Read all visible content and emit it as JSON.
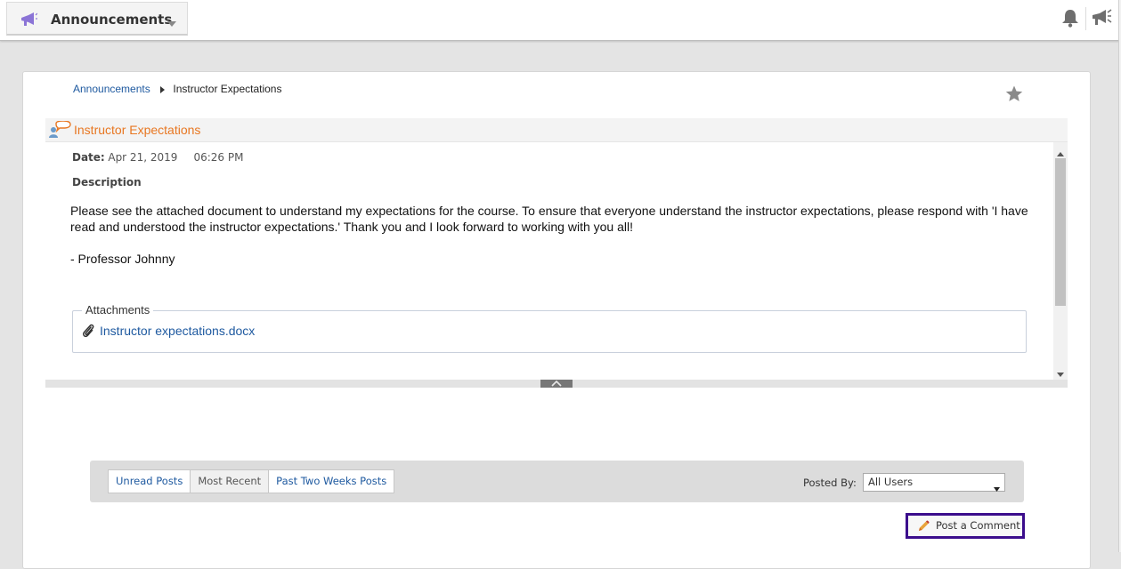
{
  "topbar": {
    "tool_title": "Announcements"
  },
  "breadcrumb": {
    "parent": "Announcements",
    "current": "Instructor Expectations"
  },
  "post": {
    "title": "Instructor Expectations",
    "date_label": "Date:",
    "date_value": "Apr 21, 2019",
    "time_value": "06:26 PM",
    "description_label": "Description",
    "description": "Please see the attached document to understand my expectations for the course. To ensure that everyone understand the instructor expectations, please respond with 'I have read and understood the instructor expectations.' Thank you and I look forward to working with you all!",
    "signature": "- Professor Johnny",
    "attachments_label": "Attachments",
    "attachment_file": "Instructor expectations.docx"
  },
  "filters": {
    "tabs": [
      "Unread Posts",
      "Most Recent",
      "Past Two Weeks Posts"
    ],
    "active_tab": "Most Recent",
    "posted_by_label": "Posted By:",
    "posted_by_value": "All Users"
  },
  "actions": {
    "post_comment": "Post a Comment"
  },
  "colors": {
    "link": "#1f5aa0",
    "post_title": "#e87722",
    "comment_button_border": "#3b0d8c",
    "megaphone": "#8b74d6"
  },
  "icons": {
    "tool": "megaphone-icon",
    "notifications": "bell-icon",
    "announcements": "megaphone-icon",
    "favorite": "star-icon",
    "post": "discussion-user-icon",
    "attachment": "paperclip-icon",
    "comment": "pencil-icon"
  }
}
